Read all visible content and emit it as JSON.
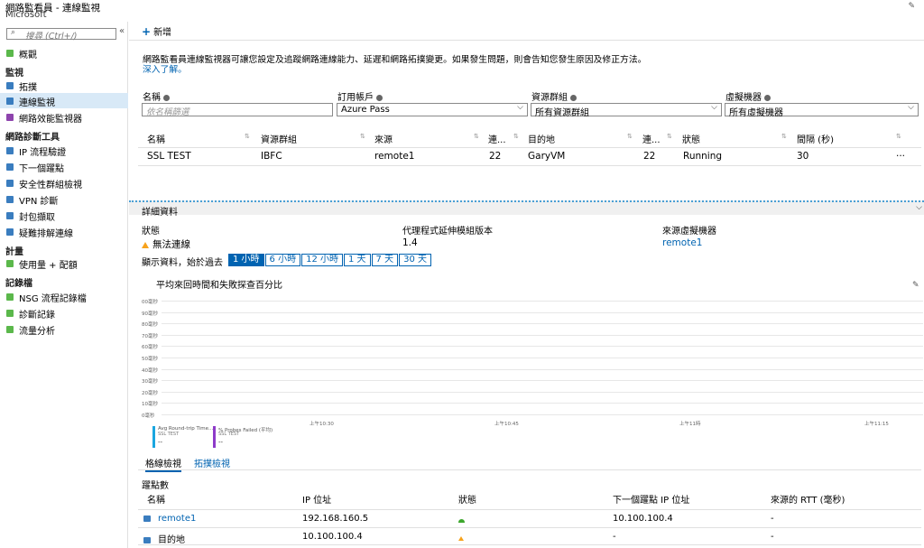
{
  "titlebar": {
    "title": "網路監看員 - 連線監視",
    "subtitle": "Microsoft"
  },
  "sidebar": {
    "search_placeholder": "搜尋 (Ctrl+/)",
    "collapse": "«",
    "items": [
      {
        "label": "概觀",
        "icon": "overview-icon",
        "color": "#5bb84b"
      },
      {
        "section": "監視"
      },
      {
        "label": "拓撲",
        "icon": "topology-icon",
        "color": "#3a7dbf"
      },
      {
        "label": "連線監視",
        "icon": "connection-monitor-icon",
        "color": "#3a7dbf",
        "active": true
      },
      {
        "label": "網路效能監視器",
        "icon": "performance-icon",
        "color": "#8e44ad"
      },
      {
        "section": "網路診斷工具"
      },
      {
        "label": "IP 流程驗證",
        "icon": "ip-flow-icon",
        "color": "#3a7dbf"
      },
      {
        "label": "下一個躍點",
        "icon": "next-hop-icon",
        "color": "#3a7dbf"
      },
      {
        "label": "安全性群組檢視",
        "icon": "security-group-icon",
        "color": "#3a7dbf"
      },
      {
        "label": "VPN 診斷",
        "icon": "vpn-icon",
        "color": "#3a7dbf"
      },
      {
        "label": "封包擷取",
        "icon": "packet-capture-icon",
        "color": "#3a7dbf"
      },
      {
        "label": "疑難排解連線",
        "icon": "troubleshoot-icon",
        "color": "#3a7dbf"
      },
      {
        "section": "計量"
      },
      {
        "label": "使用量 + 配額",
        "icon": "usage-icon",
        "color": "#5bb84b"
      },
      {
        "section": "記錄檔"
      },
      {
        "label": "NSG 流程記錄檔",
        "icon": "nsg-log-icon",
        "color": "#5bb84b"
      },
      {
        "label": "診斷記錄",
        "icon": "diagnostic-log-icon",
        "color": "#5bb84b"
      },
      {
        "label": "流量分析",
        "icon": "traffic-analytics-icon",
        "color": "#5bb84b"
      }
    ]
  },
  "toolbar": {
    "add_label": "新增"
  },
  "description": "網路監看員連線監視器可讓您設定及追蹤網路連線能力、延遲和網路拓撲變更。如果發生問題，則會告知您發生原因及修正方法。",
  "learn_more": "深入了解。",
  "filters": {
    "name_label": "名稱",
    "name_placeholder": "依名稱篩選",
    "subscription_label": "訂用帳戶",
    "subscription_value": "Azure Pass",
    "resource_group_label": "資源群組",
    "resource_group_value": "所有資源群組",
    "vm_label": "虛擬機器",
    "vm_value": "所有虛擬機器"
  },
  "table": {
    "headers": [
      "名稱",
      "資源群組",
      "來源",
      "連...",
      "目的地",
      "連...",
      "狀態",
      "間隔 (秒)"
    ],
    "row": [
      "SSL TEST",
      "IBFC",
      "remote1",
      "22",
      "GaryVM",
      "22",
      "Running",
      "30"
    ],
    "more": "..."
  },
  "details": {
    "title": "詳細資料",
    "status_label": "狀態",
    "status_value": "無法連線",
    "agent_label": "代理程式延伸模組版本",
    "agent_value": "1.4",
    "source_vm_label": "來源虛擬機器",
    "source_vm_value": "remote1",
    "time_label": "顯示資料，始於過去",
    "time_options": [
      "1 小時",
      "6 小時",
      "12 小時",
      "1 天",
      "7 天",
      "30 天"
    ],
    "chart_title": "平均來回時間和失敗探查百分比"
  },
  "chart_data": {
    "type": "line",
    "title": "平均來回時間和失敗探查百分比",
    "y_ticks": [
      "00毫秒",
      "90毫秒",
      "80毫秒",
      "70毫秒",
      "60毫秒",
      "50毫秒",
      "40毫秒",
      "30毫秒",
      "20毫秒",
      "10毫秒",
      "0毫秒"
    ],
    "x_ticks": [
      "上午10:30",
      "上午10:45",
      "上午11時",
      "上午11:15"
    ],
    "series": [
      {
        "name": "Avg Round-trip Time...",
        "source": "SSL TEST",
        "value": "--",
        "color": "#1aa6e0"
      },
      {
        "name": "% Probes Failed (平均)",
        "source": "SSL TEST",
        "value": "--",
        "color": "#8e3bc9"
      }
    ]
  },
  "view_tabs": [
    "格線檢視",
    "拓撲檢視"
  ],
  "hops": {
    "title": "躍點數",
    "headers": [
      "名稱",
      "IP 位址",
      "狀態",
      "下一個躍點 IP 位址",
      "來源的 RTT (毫秒)"
    ],
    "rows": [
      {
        "name": "remote1",
        "ip": "192.168.160.5",
        "status": "up",
        "next": "10.100.100.4",
        "rtt": "-"
      },
      {
        "name": "目的地",
        "ip": "10.100.100.4",
        "status": "warning",
        "next": "-",
        "rtt": "-"
      }
    ]
  }
}
